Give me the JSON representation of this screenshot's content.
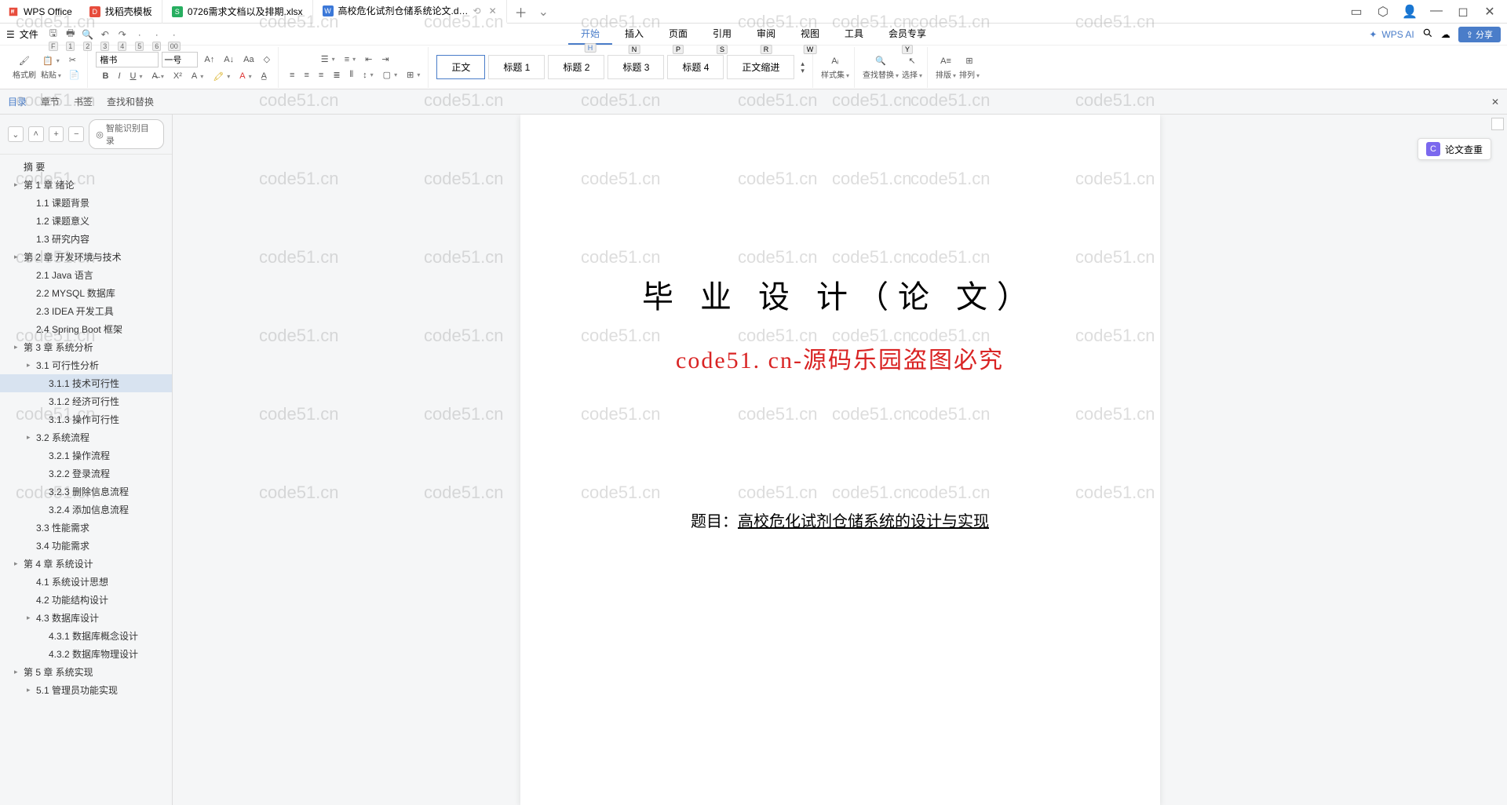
{
  "app": {
    "name": "WPS Office"
  },
  "tabs": [
    {
      "icon_bg": "#e74c3c",
      "icon_letter": "D",
      "label": "找稻壳模板"
    },
    {
      "icon_bg": "#27ae60",
      "icon_letter": "S",
      "label": "0726需求文档以及排期.xlsx"
    },
    {
      "icon_bg": "#3b78d8",
      "icon_letter": "W",
      "label": "高校危化试剂仓储系统论文.d…"
    }
  ],
  "file_label": "文件",
  "qat_keys": [
    "F",
    "1",
    "2",
    "3",
    "4",
    "5",
    "6",
    "00"
  ],
  "menus": [
    {
      "label": "开始",
      "key": "H",
      "active": true
    },
    {
      "label": "插入",
      "key": "N"
    },
    {
      "label": "页面",
      "key": "P"
    },
    {
      "label": "引用",
      "key": "S"
    },
    {
      "label": "审阅",
      "key": "R"
    },
    {
      "label": "视图",
      "key": "W"
    },
    {
      "label": "工具",
      "key": " "
    },
    {
      "label": "会员专享",
      "key": "Y"
    }
  ],
  "wps_ai": "WPS AI",
  "share": "分享",
  "ribbon": {
    "format_painter": "格式刷",
    "paste": "粘贴",
    "font": "楷书",
    "size": "一号",
    "styles": [
      "正文",
      "标题 1",
      "标题 2",
      "标题 3",
      "标题 4",
      "正文缩进"
    ],
    "style_set": "样式集",
    "find_replace": "查找替换",
    "select": "选择",
    "arrange_v": "排版",
    "arrange_h": "排列"
  },
  "nav_tabs": {
    "toc": "目录",
    "chapter": "章节",
    "bookmark": "书签",
    "find": "查找和替换"
  },
  "smart_toc": "智能识别目录",
  "outline": [
    {
      "level": 0,
      "caret": "",
      "text": "摘 要"
    },
    {
      "level": 1,
      "caret": "▸",
      "text": "第 1 章 绪论"
    },
    {
      "level": 2,
      "caret": "",
      "text": "1.1 课题背景"
    },
    {
      "level": 2,
      "caret": "",
      "text": "1.2 课题意义"
    },
    {
      "level": 2,
      "caret": "",
      "text": "1.3 研究内容"
    },
    {
      "level": 1,
      "caret": "▸",
      "text": "第 2 章 开发环境与技术"
    },
    {
      "level": 2,
      "caret": "",
      "text": "2.1 Java 语言"
    },
    {
      "level": 2,
      "caret": "",
      "text": "2.2 MYSQL 数据库"
    },
    {
      "level": 2,
      "caret": "",
      "text": "2.3 IDEA 开发工具"
    },
    {
      "level": 2,
      "caret": "",
      "text": "2.4 Spring Boot 框架"
    },
    {
      "level": 1,
      "caret": "▸",
      "text": "第 3 章 系统分析"
    },
    {
      "level": 2,
      "caret": "▸",
      "text": "3.1 可行性分析"
    },
    {
      "level": 3,
      "caret": "",
      "text": "3.1.1 技术可行性",
      "selected": true
    },
    {
      "level": 3,
      "caret": "",
      "text": "3.1.2 经济可行性"
    },
    {
      "level": 3,
      "caret": "",
      "text": "3.1.3 操作可行性"
    },
    {
      "level": 2,
      "caret": "▸",
      "text": "3.2 系统流程"
    },
    {
      "level": 3,
      "caret": "",
      "text": "3.2.1 操作流程"
    },
    {
      "level": 3,
      "caret": "",
      "text": "3.2.2 登录流程"
    },
    {
      "level": 3,
      "caret": "",
      "text": "3.2.3 删除信息流程"
    },
    {
      "level": 3,
      "caret": "",
      "text": "3.2.4 添加信息流程"
    },
    {
      "level": 2,
      "caret": "",
      "text": "3.3 性能需求"
    },
    {
      "level": 2,
      "caret": "",
      "text": "3.4 功能需求"
    },
    {
      "level": 1,
      "caret": "▸",
      "text": "第 4 章 系统设计"
    },
    {
      "level": 2,
      "caret": "",
      "text": "4.1 系统设计思想"
    },
    {
      "level": 2,
      "caret": "",
      "text": "4.2 功能结构设计"
    },
    {
      "level": 2,
      "caret": "▸",
      "text": "4.3 数据库设计"
    },
    {
      "level": 3,
      "caret": "",
      "text": "4.3.1 数据库概念设计"
    },
    {
      "level": 3,
      "caret": "",
      "text": "4.3.2 数据库物理设计"
    },
    {
      "level": 1,
      "caret": "▸",
      "text": "第 5 章 系统实现"
    },
    {
      "level": 2,
      "caret": "▸",
      "text": "5.1 管理员功能实现"
    }
  ],
  "document": {
    "title": "毕 业 设 计（论 文）",
    "red_line": "code51. cn-源码乐园盗图必究",
    "subject_label": "题目：",
    "subject_value": "高校危化试剂仓储系统的设计与实现"
  },
  "paper_check": "论文查重",
  "watermark": "code51.cn"
}
